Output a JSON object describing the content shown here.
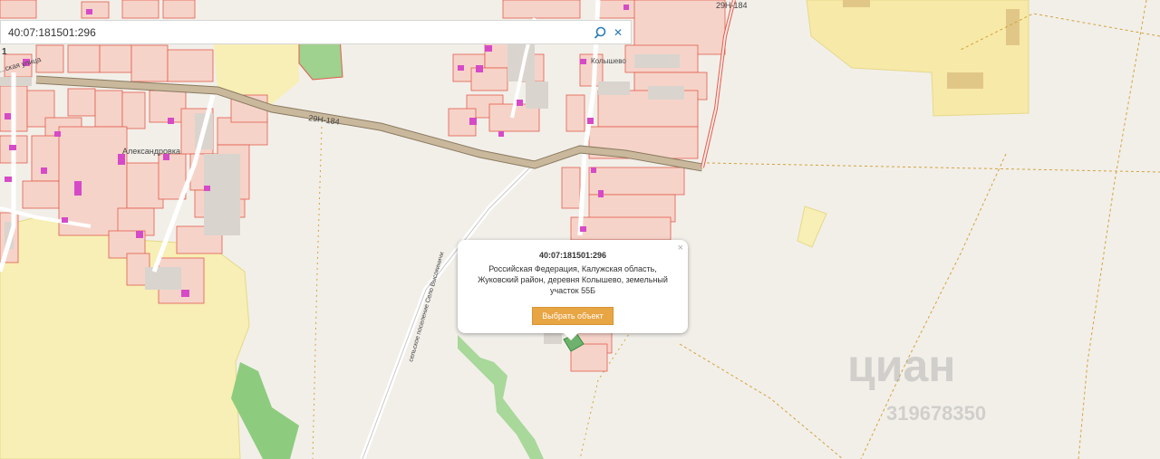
{
  "search": {
    "value": "40:07:181501:296",
    "placeholder": ""
  },
  "icons": {
    "search": "search-icon",
    "clear": "close-icon",
    "popup_close": "close-icon"
  },
  "map_labels": {
    "road1": "29Н-184",
    "road2": "29Н-184",
    "village1": "Александровка",
    "village2": "Колышево",
    "settlement": "сельское поселение Село Высокиничи",
    "street": "...ская улица",
    "edge_num": "1"
  },
  "popup": {
    "title": "40:07:181501:296",
    "address": "Российская Федерация, Калужская область, Жуковский район, деревня Колышево, земельный участок 55Б",
    "button": "Выбрать объект",
    "close": "×"
  },
  "watermark": {
    "brand": "циан",
    "id": "319678350"
  },
  "colors": {
    "background": "#f2efe9",
    "parcel_fill": "#f6d3c9",
    "parcel_stroke": "#e25d4d",
    "building": "#d64ac8",
    "road": "#c9b89c",
    "yellow_zone": "#f7efb5",
    "green_zone": "#8dcc7e",
    "button": "#e8a543",
    "search_icon": "#2a7ab8"
  }
}
